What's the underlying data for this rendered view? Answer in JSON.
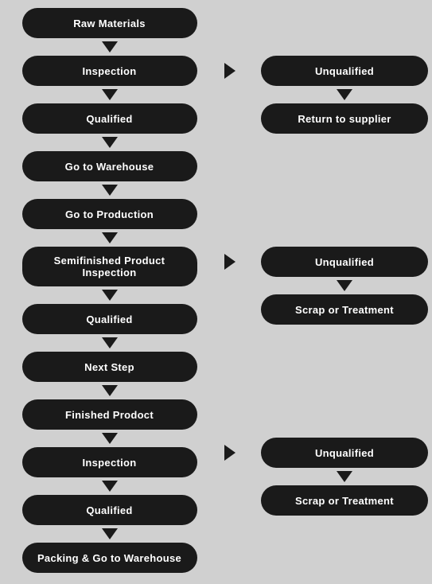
{
  "nodes": {
    "raw_materials": "Raw Materials",
    "inspection1": "Inspection",
    "qualified1": "Qualified",
    "go_to_warehouse": "Go to Warehouse",
    "go_to_production": "Go to Production",
    "semifinished_inspection": "Semifinished Product Inspection",
    "qualified2": "Qualified",
    "next_step": "Next Step",
    "finished_product": "Finished Prodoct",
    "inspection2": "Inspection",
    "qualified3": "Qualified",
    "packing": "Packing & Go to Warehouse"
  },
  "side_nodes": {
    "unqualified1": "Unqualified",
    "return_supplier": "Return to supplier",
    "unqualified2": "Unqualified",
    "scrap_treatment1": "Scrap or Treatment",
    "unqualified3": "Unqualified",
    "scrap_treatment2": "Scrap or Treatment"
  }
}
